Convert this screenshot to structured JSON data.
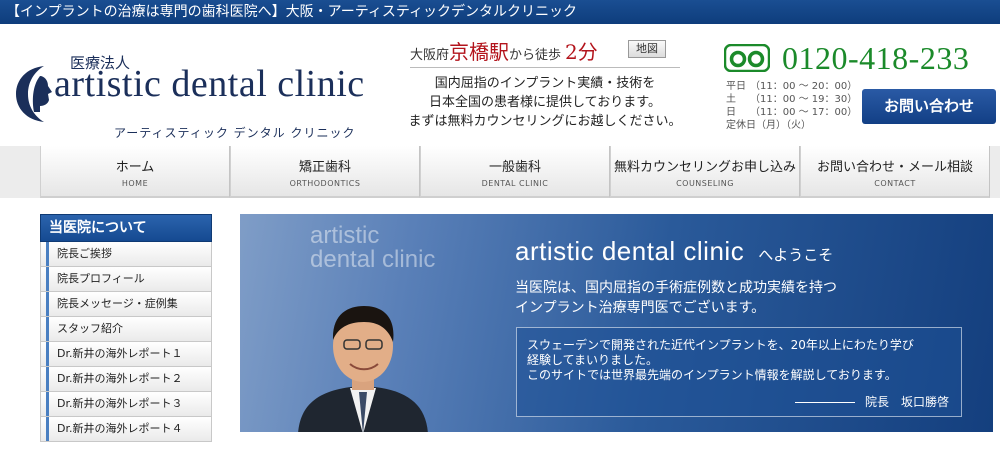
{
  "page_title": "【インプラントの治療は専門の歯科医院へ】大阪・アーティスティックデンタルクリニック",
  "logo": {
    "corp": "医療法人",
    "name": "artistic dental clinic",
    "kana": "アーティスティック デンタル クリニック"
  },
  "access": {
    "pref": "大阪府",
    "station": "京橋駅",
    "walk": "から徒歩",
    "minutes": "2分",
    "map_label": "地図"
  },
  "intro": [
    "国内屈指のインプラント実績・技術を",
    "日本全国の患者様に提供しております。",
    "まずは無料カウンセリングにお越しください。"
  ],
  "phone": {
    "number": "0120-418-233"
  },
  "hours": [
    {
      "day": "平日",
      "time": "（11：00 〜 20：00）"
    },
    {
      "day": "土",
      "time": "（11：00 〜 19：30）"
    },
    {
      "day": "日",
      "time": "（11：00 〜 17：00）"
    },
    {
      "day": "定休日",
      "time": "（月）（火）"
    }
  ],
  "contact_button": "お問い合わせ",
  "nav": [
    {
      "ja": "ホーム",
      "en": "HOME"
    },
    {
      "ja": "矯正歯科",
      "en": "ORTHODONTICS"
    },
    {
      "ja": "一般歯科",
      "en": "DENTAL CLINIC"
    },
    {
      "ja": "無料カウンセリングお申し込み",
      "en": "COUNSELING"
    },
    {
      "ja": "お問い合わせ・メール相談",
      "en": "CONTACT"
    }
  ],
  "sidebar": {
    "heading": "当医院について",
    "items": [
      "院長ご挨拶",
      "院長プロフィール",
      "院長メッセージ・症例集",
      "スタッフ紹介",
      "Dr.新井の海外レポート１",
      "Dr.新井の海外レポート２",
      "Dr.新井の海外レポート３",
      "Dr.新井の海外レポート４"
    ]
  },
  "hero": {
    "watermark1": "artistic",
    "watermark2": "dental clinic",
    "title_en": "artistic dental clinic",
    "title_ja": "へようこそ",
    "lead1": "当医院は、国内屈指の手術症例数と成功実績を持つ",
    "lead2": "インプラント治療専門医でございます。",
    "box1": "スウェーデンで開発された近代インプラントを、20年以上にわたり学び",
    "box2": "経験してまいりました。",
    "box3": "このサイトでは世界最先端のインプラント情報を解説しております。",
    "sign": "院長　坂口勝啓"
  }
}
